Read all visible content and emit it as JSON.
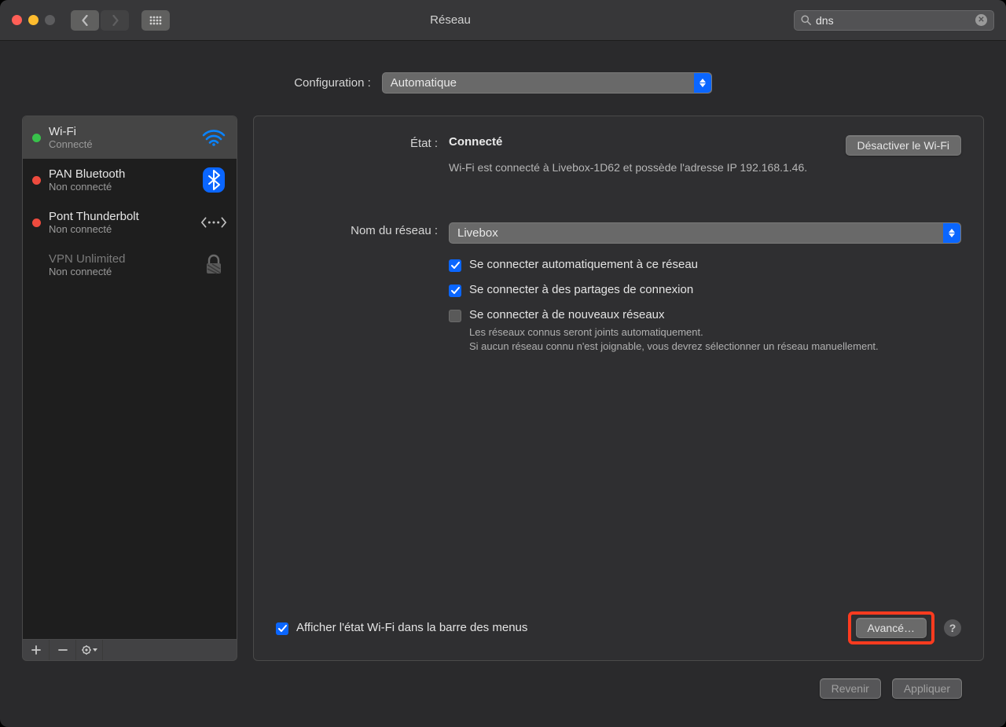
{
  "window": {
    "title": "Réseau"
  },
  "search": {
    "placeholder": "",
    "value": "dns"
  },
  "config": {
    "label": "Configuration :",
    "value": "Automatique"
  },
  "sidebar": {
    "items": [
      {
        "name": "Wi-Fi",
        "status": "Connecté"
      },
      {
        "name": "PAN Bluetooth",
        "status": "Non connecté"
      },
      {
        "name": "Pont Thunderbolt",
        "status": "Non connecté"
      },
      {
        "name": "VPN Unlimited",
        "status": "Non connecté"
      }
    ]
  },
  "detail": {
    "state_label": "État :",
    "state_value": "Connecté",
    "disable_wifi": "Désactiver le Wi-Fi",
    "state_desc": "Wi-Fi est connecté à Livebox-1D62 et possède l'adresse IP 192.168.1.46.",
    "network_label": "Nom du réseau :",
    "network_value": "Livebox",
    "cb_auto": "Se connecter automatiquement à ce réseau",
    "cb_hotspot": "Se connecter à des partages de connexion",
    "cb_new": "Se connecter à de nouveaux réseaux",
    "explain": "Les réseaux connus seront joints automatiquement.\nSi aucun réseau connu n'est joignable, vous devrez sélectionner un réseau manuellement.",
    "show_menubar": "Afficher l'état Wi-Fi dans la barre des menus",
    "advanced": "Avancé…"
  },
  "footer": {
    "revert": "Revenir",
    "apply": "Appliquer"
  }
}
